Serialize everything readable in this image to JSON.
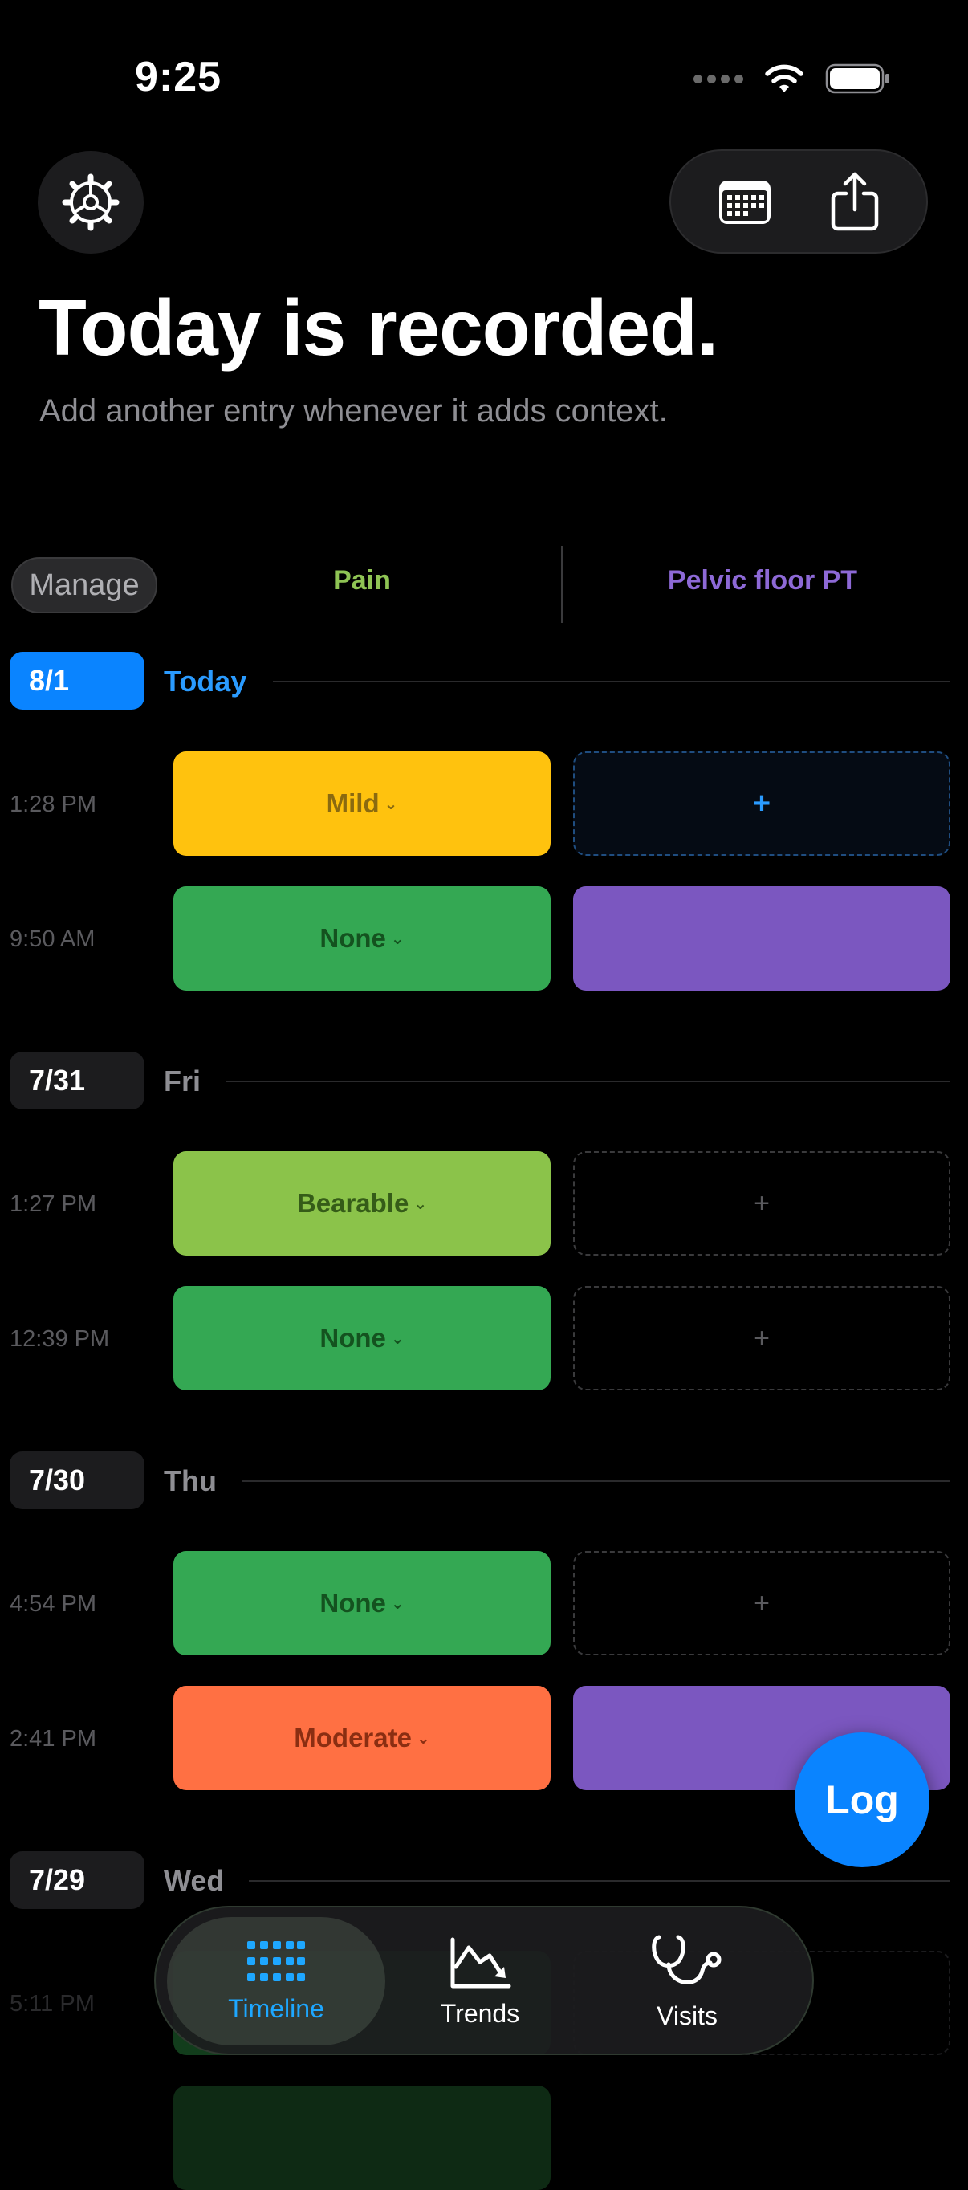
{
  "status": {
    "time": "9:25"
  },
  "header": {
    "title": "Today is recorded.",
    "subtitle": "Add another entry whenever it adds context."
  },
  "columns": {
    "manage_label": "Manage",
    "pain": "Pain",
    "pt": "Pelvic floor PT",
    "pain_color": "#8fc454",
    "pt_color": "#8d69d6"
  },
  "days": [
    {
      "date": "8/1",
      "label": "Today",
      "is_today": true,
      "entries": [
        {
          "time": "1:28 PM",
          "pain": "Mild",
          "pain_color": "#ffc20e",
          "pt": "+",
          "pt_state": "active"
        },
        {
          "time": "9:50 AM",
          "pain": "None",
          "pain_color": "#34a853",
          "pt": "",
          "pt_state": "filled"
        }
      ]
    },
    {
      "date": "7/31",
      "label": "Fri",
      "entries": [
        {
          "time": "1:27 PM",
          "pain": "Bearable",
          "pain_color": "#8bc34a",
          "pt": "+",
          "pt_state": "empty"
        },
        {
          "time": "12:39 PM",
          "pain": "None",
          "pain_color": "#34a853",
          "pt": "+",
          "pt_state": "empty"
        }
      ]
    },
    {
      "date": "7/30",
      "label": "Thu",
      "entries": [
        {
          "time": "4:54 PM",
          "pain": "None",
          "pain_color": "#34a853",
          "pt": "+",
          "pt_state": "empty"
        },
        {
          "time": "2:41 PM",
          "pain": "Moderate",
          "pain_color": "#ff7043",
          "pt": "",
          "pt_state": "filled"
        }
      ]
    },
    {
      "date": "7/29",
      "label": "Wed",
      "entries": [
        {
          "time": "5:11 PM"
        }
      ]
    }
  ],
  "fab": {
    "label": "Log"
  },
  "tabs": [
    {
      "label": "Timeline",
      "icon": "grid-icon",
      "active": true
    },
    {
      "label": "Trends",
      "icon": "chart-trend-icon"
    },
    {
      "label": "Visits",
      "icon": "stethoscope-icon"
    }
  ]
}
